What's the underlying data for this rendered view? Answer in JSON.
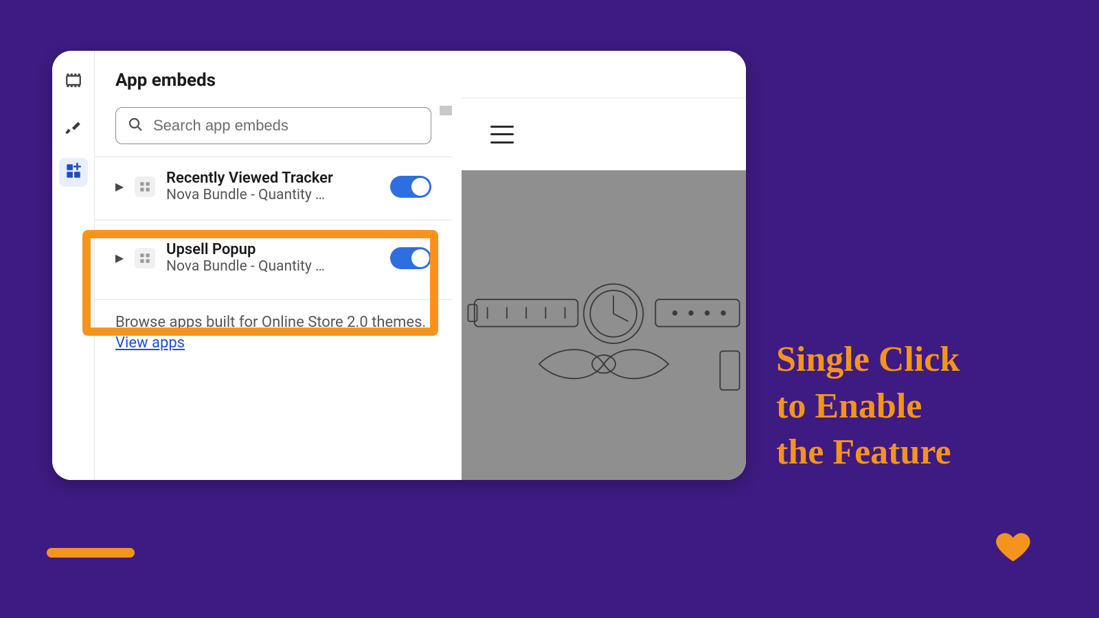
{
  "sidebar": {
    "title": "App embeds",
    "search_placeholder": "Search app embeds",
    "browse_text": "Browse apps built for Online Store 2.0 themes. ",
    "browse_link": "View apps"
  },
  "embeds": [
    {
      "name": "Recently Viewed Tracker",
      "sub": "Nova Bundle - Quantity …",
      "enabled": true,
      "highlighted": false
    },
    {
      "name": "Upsell Popup",
      "sub": "Nova Bundle - Quantity …",
      "enabled": true,
      "highlighted": true
    }
  ],
  "rail_icons": [
    "sections-icon",
    "brush-icon",
    "apps-icon"
  ],
  "promo": {
    "line1": "Single Click",
    "line2": "to Enable",
    "line3": "the Feature"
  },
  "colors": {
    "accent": "#f5941c",
    "brand_bg": "#3d1b82",
    "toggle_on": "#2e6fe0"
  }
}
